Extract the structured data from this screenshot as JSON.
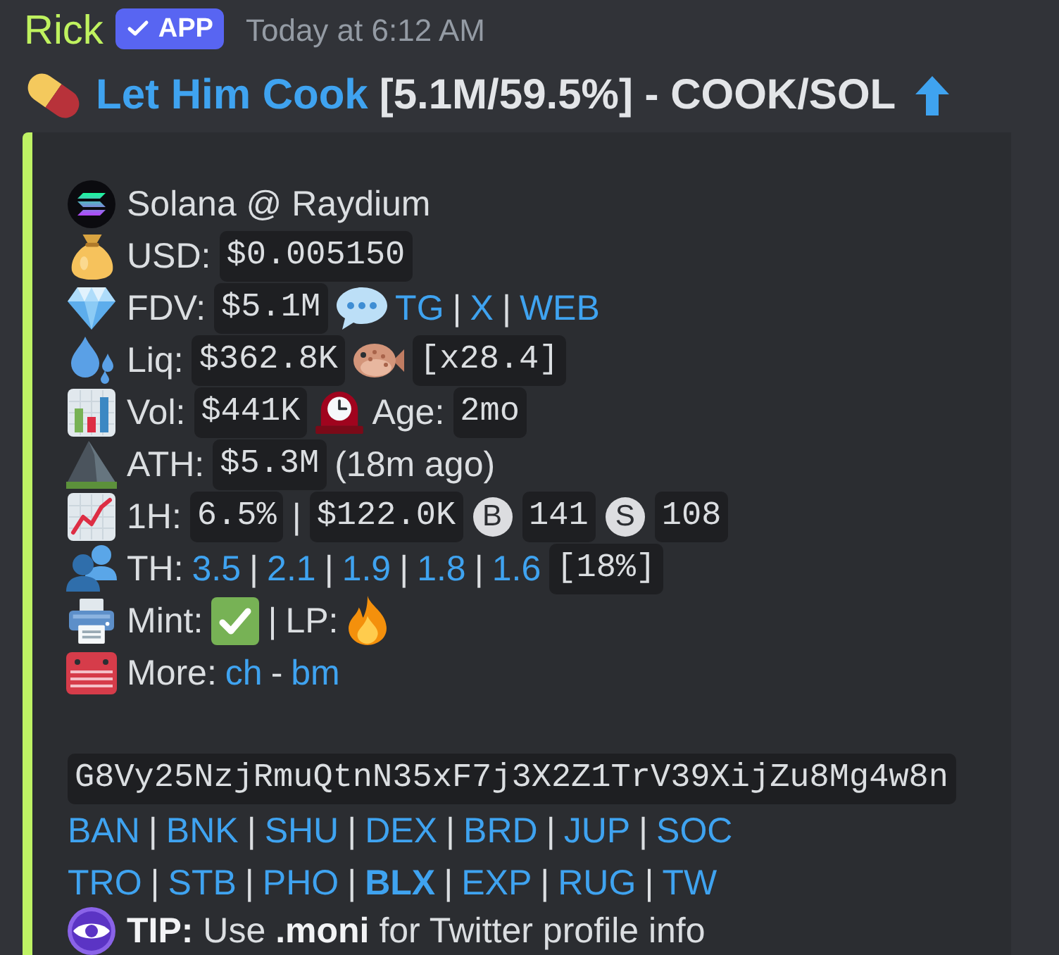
{
  "message": {
    "author": "Rick",
    "badge": "APP",
    "timestamp": "Today at 6:12 AM",
    "title": {
      "parts": [
        {
          "kind": "link",
          "text": "Let Him Cook"
        },
        {
          "kind": "text",
          "text": "[5.1M/59.5%] - COOK/SOL"
        }
      ],
      "rising": true
    }
  },
  "embed": {
    "rows": [
      {
        "kind": "chain",
        "parts": [
          {
            "kind": "text",
            "text": "Solana @ Raydium"
          }
        ]
      },
      {
        "kind": "price",
        "parts": [
          {
            "kind": "label",
            "text": "USD:"
          },
          {
            "kind": "code",
            "text": "$0.005150"
          }
        ]
      },
      {
        "kind": "fdv",
        "parts": [
          {
            "kind": "label",
            "text": "FDV:"
          },
          {
            "kind": "code",
            "text": "$5.1M"
          },
          {
            "kind": "socials"
          },
          {
            "kind": "link",
            "text": "TG"
          },
          {
            "kind": "sep",
            "text": "|"
          },
          {
            "kind": "link",
            "text": "X"
          },
          {
            "kind": "sep",
            "text": "|"
          },
          {
            "kind": "link",
            "text": "WEB"
          }
        ]
      },
      {
        "kind": "liquidity",
        "parts": [
          {
            "kind": "label",
            "text": "Liq:"
          },
          {
            "kind": "code",
            "text": "$362.8K"
          },
          {
            "kind": "ratio"
          },
          {
            "kind": "code",
            "text": "[x28.4]"
          }
        ]
      },
      {
        "kind": "volume",
        "parts": [
          {
            "kind": "label",
            "text": "Vol:"
          },
          {
            "kind": "code",
            "text": "$441K"
          },
          {
            "kind": "age"
          },
          {
            "kind": "label",
            "text": "Age:"
          },
          {
            "kind": "code",
            "text": "2mo"
          }
        ]
      },
      {
        "kind": "ath",
        "parts": [
          {
            "kind": "label",
            "text": "ATH:"
          },
          {
            "kind": "code",
            "text": "$5.3M"
          },
          {
            "kind": "text",
            "text": "(18m ago)"
          }
        ]
      },
      {
        "kind": "hour",
        "parts": [
          {
            "kind": "label",
            "text": "1H:"
          },
          {
            "kind": "code",
            "text": "6.5%"
          },
          {
            "kind": "sep",
            "text": "|"
          },
          {
            "kind": "code",
            "text": "$122.0K"
          },
          {
            "kind": "buy",
            "text": "B"
          },
          {
            "kind": "code",
            "text": "141"
          },
          {
            "kind": "sell",
            "text": "S"
          },
          {
            "kind": "code",
            "text": "108"
          }
        ]
      },
      {
        "kind": "holders",
        "parts": [
          {
            "kind": "label",
            "text": "TH:"
          },
          {
            "kind": "link",
            "text": "3.5"
          },
          {
            "kind": "sep",
            "text": "|"
          },
          {
            "kind": "link",
            "text": "2.1"
          },
          {
            "kind": "sep",
            "text": "|"
          },
          {
            "kind": "link",
            "text": "1.9"
          },
          {
            "kind": "sep",
            "text": "|"
          },
          {
            "kind": "link",
            "text": "1.8"
          },
          {
            "kind": "sep",
            "text": "|"
          },
          {
            "kind": "link",
            "text": "1.6"
          },
          {
            "kind": "code",
            "text": "[18%]"
          }
        ]
      },
      {
        "kind": "security",
        "parts": [
          {
            "kind": "label",
            "text": "Mint:"
          },
          {
            "kind": "mint",
            "ok": true
          },
          {
            "kind": "sep",
            "text": "|"
          },
          {
            "kind": "label",
            "text": "LP:"
          },
          {
            "kind": "lp",
            "burned": true
          }
        ]
      },
      {
        "kind": "more",
        "parts": [
          {
            "kind": "label",
            "text": "More:"
          },
          {
            "kind": "link",
            "text": "ch"
          },
          {
            "kind": "sep",
            "text": "-"
          },
          {
            "kind": "link",
            "text": "bm"
          }
        ]
      },
      {
        "kind": "address",
        "parts": [
          {
            "kind": "code",
            "text": "G8Vy25NzjRmuQtnN35xF7j3X2Z1TrV39XijZu8Mg4w8n"
          }
        ]
      },
      {
        "kind": "links",
        "parts": [
          {
            "kind": "link",
            "text": "BAN",
            "bold": false
          },
          {
            "kind": "sep",
            "text": "|"
          },
          {
            "kind": "link",
            "text": "BNK",
            "bold": false
          },
          {
            "kind": "sep",
            "text": "|"
          },
          {
            "kind": "link",
            "text": "SHU",
            "bold": false
          },
          {
            "kind": "sep",
            "text": "|"
          },
          {
            "kind": "link",
            "text": "DEX",
            "bold": false
          },
          {
            "kind": "sep",
            "text": "|"
          },
          {
            "kind": "link",
            "text": "BRD",
            "bold": false
          },
          {
            "kind": "sep",
            "text": "|"
          },
          {
            "kind": "link",
            "text": "JUP",
            "bold": false
          },
          {
            "kind": "sep",
            "text": "|"
          },
          {
            "kind": "link",
            "text": "SOC",
            "bold": false
          }
        ]
      },
      {
        "kind": "links",
        "parts": [
          {
            "kind": "link",
            "text": "TRO",
            "bold": false
          },
          {
            "kind": "sep",
            "text": "|"
          },
          {
            "kind": "link",
            "text": "STB",
            "bold": false
          },
          {
            "kind": "sep",
            "text": "|"
          },
          {
            "kind": "link",
            "text": "PHO",
            "bold": false
          },
          {
            "kind": "sep",
            "text": "|"
          },
          {
            "kind": "link",
            "text": "BLX",
            "bold": true
          },
          {
            "kind": "sep",
            "text": "|"
          },
          {
            "kind": "link",
            "text": "EXP",
            "bold": false
          },
          {
            "kind": "sep",
            "text": "|"
          },
          {
            "kind": "link",
            "text": "RUG",
            "bold": false
          },
          {
            "kind": "sep",
            "text": "|"
          },
          {
            "kind": "link",
            "text": "TW",
            "bold": false
          }
        ]
      },
      {
        "kind": "tip",
        "parts": [
          {
            "kind": "rich",
            "text": "**TIP:** Use **.moni** for Twitter profile info"
          }
        ]
      }
    ]
  }
}
